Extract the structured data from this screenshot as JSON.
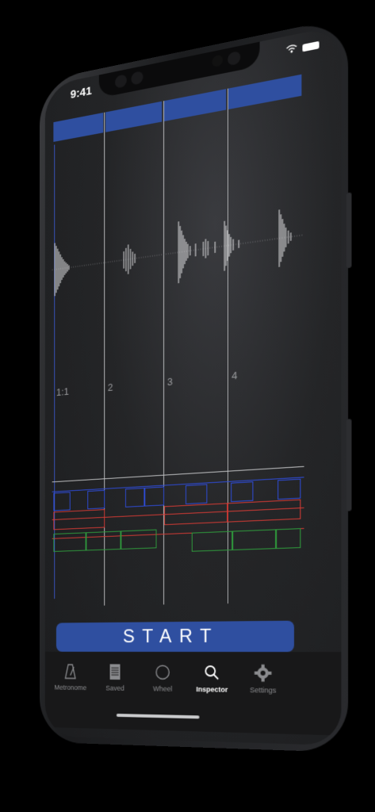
{
  "status_bar": {
    "time": "9:41"
  },
  "timeline": {
    "beat_labels": [
      "1:1",
      "2",
      "3",
      "4"
    ]
  },
  "start_button": {
    "label": "START"
  },
  "tabs": [
    {
      "label": "Metronome",
      "icon": "metronome-icon",
      "active": false
    },
    {
      "label": "Saved",
      "icon": "document-icon",
      "active": false
    },
    {
      "label": "Wheel",
      "icon": "circle-icon",
      "active": false
    },
    {
      "label": "Inspector",
      "icon": "magnifier-icon",
      "active": true
    },
    {
      "label": "Settings",
      "icon": "gear-icon",
      "active": false
    }
  ],
  "colors": {
    "accent": "#2f4fa0",
    "track_blue": "#2e4bd6",
    "track_red": "#d23a34",
    "track_green": "#2f9a3c"
  }
}
